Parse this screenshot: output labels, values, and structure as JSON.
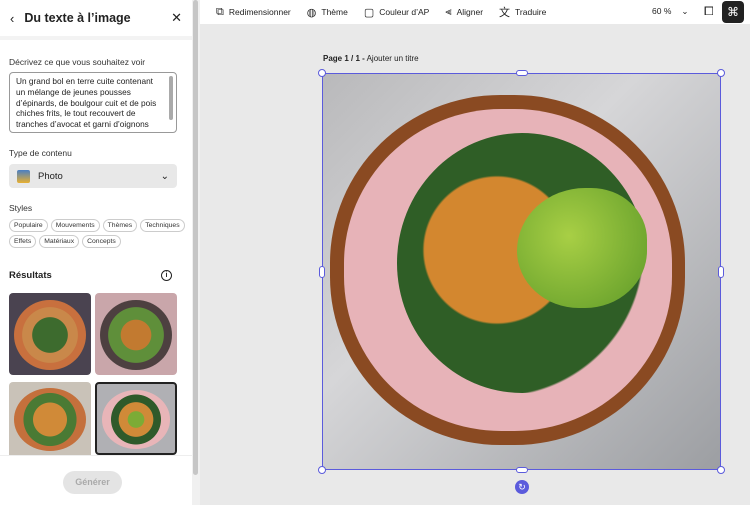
{
  "panel": {
    "title": "Du texte à l’image",
    "prompt_label": "Décrivez ce que vous souhaitez voir",
    "prompt_value": "Un grand bol en terre cuite contenant un mélange de jeunes pousses d’épinards, de boulgour cuit et de pois chiches frits, le tout recouvert de tranches d’avocat et garni d’oignons rouges marinés rose clair",
    "content_type_label": "Type de contenu",
    "content_type_value": "Photo",
    "styles_label": "Styles",
    "styles": [
      "Populaire",
      "Mouvements",
      "Thèmes",
      "Techniques",
      "Effets",
      "Matériaux",
      "Concepts"
    ],
    "results_label": "Résultats",
    "generate_label": "Générer"
  },
  "toolbar": {
    "items": [
      "Redimensionner",
      "Thème",
      "Couleur d’AP",
      "Aligner",
      "Traduire"
    ],
    "zoom": "60 %"
  },
  "canvas": {
    "page_label": "Page 1 / 1 -",
    "page_title_placeholder": "Ajouter un titre"
  },
  "colors": {
    "selection": "#5b5bdc",
    "accent_dark": "#222222"
  }
}
